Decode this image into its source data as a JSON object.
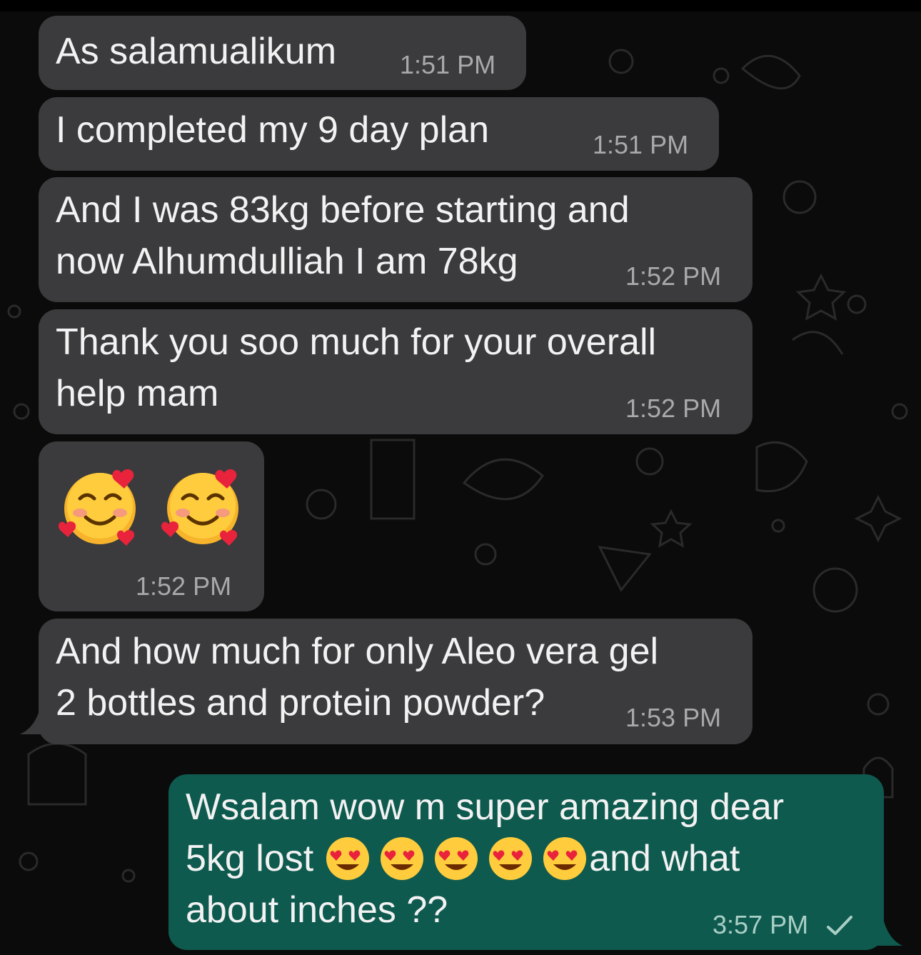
{
  "messages": [
    {
      "direction": "incoming",
      "text": "As salamualikum",
      "time": "1:51 PM"
    },
    {
      "direction": "incoming",
      "text": "I completed my 9 day plan",
      "time": "1:51 PM"
    },
    {
      "direction": "incoming",
      "text": "And I was 83kg before starting and\nnow Alhumdulliah I am 78kg",
      "time": "1:52 PM"
    },
    {
      "direction": "incoming",
      "text": "Thank you soo much for your overall\nhelp mam",
      "time": "1:52 PM"
    },
    {
      "direction": "incoming",
      "emojis": [
        "smiling-face-with-hearts",
        "smiling-face-with-hearts"
      ],
      "time": "1:52 PM"
    },
    {
      "direction": "incoming",
      "text": "And how much for only Aleo vera gel\n2 bottles and protein powder?",
      "time": "1:53 PM"
    },
    {
      "direction": "outgoing",
      "text_line1": "Wsalam wow m super amazing dear",
      "text_line2_prefix": "5kg lost",
      "emojis": [
        "heart-eyes",
        "heart-eyes",
        "heart-eyes",
        "heart-eyes",
        "heart-eyes"
      ],
      "text_line2_suffix": "and what",
      "text_line3": "about inches ??",
      "time": "3:57 PM",
      "status_icon": "single-check-icon"
    }
  ],
  "colors": {
    "incoming_bubble": "#3b3b3d",
    "outgoing_bubble": "#0f5a4f",
    "background": "#0b0b0b"
  }
}
